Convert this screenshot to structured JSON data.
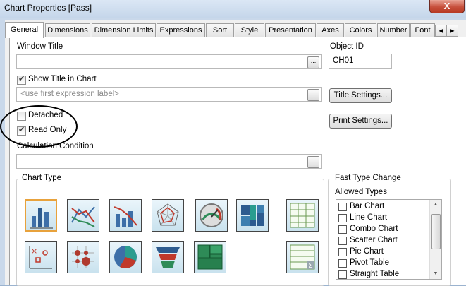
{
  "window": {
    "title": "Chart Properties [Pass]",
    "close_label": "X"
  },
  "tabs": [
    {
      "label": "General",
      "active": true
    },
    {
      "label": "Dimensions"
    },
    {
      "label": "Dimension Limits"
    },
    {
      "label": "Expressions"
    },
    {
      "label": "Sort"
    },
    {
      "label": "Style"
    },
    {
      "label": "Presentation"
    },
    {
      "label": "Axes"
    },
    {
      "label": "Colors"
    },
    {
      "label": "Number"
    },
    {
      "label": "Font"
    }
  ],
  "tab_scroll": {
    "left_icon": "◀",
    "right_icon": "▶"
  },
  "general": {
    "window_title_label": "Window Title",
    "window_title_value": "",
    "object_id_label": "Object ID",
    "object_id_value": "CH01",
    "show_title_label": "Show Title in Chart",
    "show_title_checked": true,
    "title_placeholder": "<use first expression label>",
    "title_settings_label": "Title Settings...",
    "detached_label": "Detached",
    "detached_checked": false,
    "read_only_label": "Read Only",
    "read_only_checked": true,
    "print_settings_label": "Print Settings...",
    "calc_condition_label": "Calculation Condition",
    "calc_condition_value": "",
    "ellipsis": "..."
  },
  "chart_type": {
    "group_label": "Chart Type",
    "types": [
      "bar-chart-icon",
      "line-chart-icon",
      "combo-chart-icon",
      "radar-chart-icon",
      "gauge-chart-icon",
      "mekko-chart-icon",
      "pivot-table-icon",
      "scatter-chart-icon",
      "grid-chart-icon",
      "pie-chart-icon",
      "funnel-chart-icon",
      "block-chart-icon",
      "straight-table-icon"
    ],
    "selected": "bar-chart-icon"
  },
  "fast_type_change": {
    "group_label": "Fast Type Change",
    "allowed_types_label": "Allowed Types",
    "items": [
      {
        "label": "Bar Chart",
        "checked": false
      },
      {
        "label": "Line Chart",
        "checked": false
      },
      {
        "label": "Combo Chart",
        "checked": false
      },
      {
        "label": "Scatter Chart",
        "checked": false
      },
      {
        "label": "Pie Chart",
        "checked": false
      },
      {
        "label": "Pivot Table",
        "checked": false
      },
      {
        "label": "Straight Table",
        "checked": false
      }
    ]
  },
  "colors": {
    "accent": "#e8a23c",
    "close_red": "#c7503c",
    "panel_bg": "#ffffff"
  }
}
